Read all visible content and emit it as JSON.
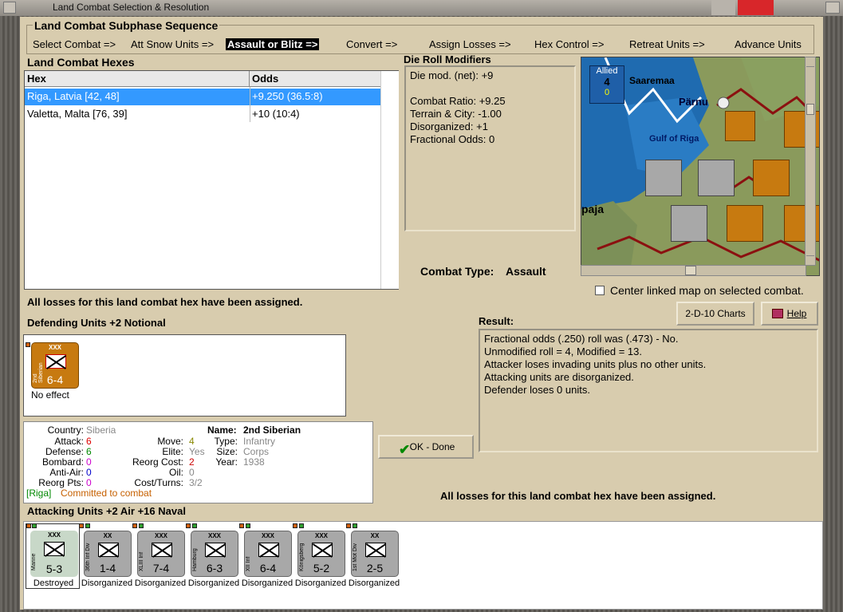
{
  "window": {
    "title": "Land Combat Selection & Resolution"
  },
  "subphase": {
    "title": "Land Combat Subphase Sequence",
    "steps": [
      "Select Combat =>",
      "Att Snow Units =>",
      "Assault or Blitz =>",
      "Convert =>",
      "Assign Losses =>",
      "Hex Control =>",
      "Retreat Units =>",
      "Advance Units"
    ]
  },
  "hexes": {
    "title": "Land Combat Hexes",
    "columns": [
      "Hex",
      "Odds"
    ],
    "rows": [
      {
        "hex": "Riga, Latvia [42, 48]",
        "odds": "+9.250 (36.5:8)"
      },
      {
        "hex": "Valetta, Malta [76, 39]",
        "odds": "+10 (10:4)"
      }
    ]
  },
  "die_mods": {
    "title": "Die Roll Modifiers",
    "net": "Die mod. (net): +9",
    "lines": [
      "Combat Ratio: +9.25",
      "Terrain & City: -1.00",
      "Disorganized: +1",
      "Fractional Odds: 0"
    ]
  },
  "map": {
    "allied_label": "Allied",
    "allied_num": "4",
    "allied_sub": "0",
    "labels": [
      "Saaremaa",
      "Pärnu",
      "Gulf of Riga",
      "paja"
    ]
  },
  "combat_type": {
    "label": "Combat Type:",
    "value": "Assault"
  },
  "center_linked": "Center linked map on selected combat.",
  "buttons": {
    "charts": "2-D-10 Charts",
    "help": "Help",
    "ok": "OK - Done"
  },
  "losses_msg": "All losses for this land combat hex have been assigned.",
  "defending": {
    "title": "Defending Units +2 Notional",
    "unit": {
      "name": "2nd Siberian",
      "size": "XXX",
      "value": "6-4",
      "status": "No effect"
    }
  },
  "result": {
    "title": "Result:",
    "lines": [
      "Fractional odds (.250) roll was (.473)  - No.",
      "Unmodified roll = 4, Modified = 13.",
      "Attacker loses invading units plus no other units.",
      "Attacking units are disorganized.",
      "Defender loses 0 units."
    ]
  },
  "unit_info": {
    "country_lbl": "Country:",
    "country": "Siberia",
    "attack_lbl": "Attack:",
    "attack": "6",
    "defense_lbl": "Defense:",
    "defense": "6",
    "bombard_lbl": "Bombard:",
    "bombard": "0",
    "antiair_lbl": "Anti-Air:",
    "antiair": "0",
    "reorgpts_lbl": "Reorg Pts:",
    "reorgpts": "0",
    "move_lbl": "Move:",
    "move": "4",
    "elite_lbl": "Elite:",
    "elite": "Yes",
    "reorgcost_lbl": "Reorg Cost:",
    "reorgcost": "2",
    "oil_lbl": "Oil:",
    "oil": "0",
    "costturns_lbl": "Cost/Turns:",
    "costturns": "3/2",
    "name_lbl": "Name:",
    "name": "2nd Siberian",
    "type_lbl": "Type:",
    "type": "Infantry",
    "size_lbl": "Size:",
    "size": "Corps",
    "year_lbl": "Year:",
    "year": "1938",
    "loc": "[Riga]",
    "committed": "Committed to combat"
  },
  "attacking": {
    "title": "Attacking Units +2 Air +16 Naval",
    "units": [
      {
        "side": "Marine",
        "size": "XXX",
        "value": "5-3",
        "status": "Destroyed"
      },
      {
        "side": "36th Inf Div",
        "size": "XX",
        "value": "1-4",
        "status": "Disorganized"
      },
      {
        "side": "XLIII Inf",
        "size": "XXX",
        "value": "7-4",
        "status": "Disorganized"
      },
      {
        "side": "Hamburg",
        "size": "XXX",
        "value": "6-3",
        "status": "Disorganized"
      },
      {
        "side": "XII Inf",
        "size": "XXX",
        "value": "6-4",
        "status": "Disorganized"
      },
      {
        "side": "Königsberg",
        "size": "XXX",
        "value": "5-2",
        "status": "Disorganized"
      },
      {
        "side": "1st Mot Div",
        "size": "XX",
        "value": "2-5",
        "status": "Disorganized"
      }
    ]
  },
  "colors": {
    "accent": "#3399ff",
    "counter_grey": "#a8a8a8",
    "counter_orange": "#c77a10",
    "panel": "#d8ccae"
  }
}
